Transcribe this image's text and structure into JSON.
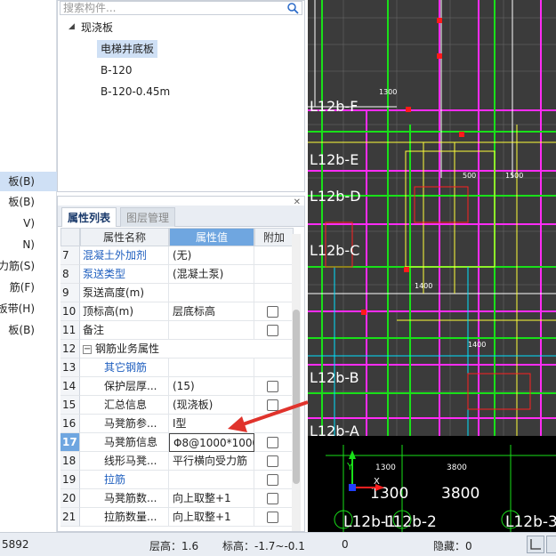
{
  "left_nav": {
    "items": [
      {
        "label": "板(B)",
        "selected": true
      },
      {
        "label": "板(B)",
        "selected": false
      },
      {
        "label": "V)",
        "selected": false
      },
      {
        "label": "N)",
        "selected": false
      },
      {
        "label": "力筋(S)",
        "selected": false
      },
      {
        "label": "筋(F)",
        "selected": false
      },
      {
        "label": "板带(H)",
        "selected": false
      },
      {
        "label": "板(B)",
        "selected": false
      }
    ]
  },
  "tree": {
    "search_placeholder": "搜索构件...",
    "root": "现浇板",
    "children": [
      {
        "label": "电梯井底板",
        "selected": true
      },
      {
        "label": "B-120",
        "selected": false
      },
      {
        "label": "B-120-0.45m",
        "selected": false
      }
    ]
  },
  "props": {
    "tabs": [
      "属性列表",
      "图层管理"
    ],
    "headers": {
      "name": "属性名称",
      "value": "属性值",
      "extra": "附加"
    },
    "rows": [
      {
        "num": "7",
        "name": "混凝土外加剂",
        "value": "(无)",
        "blue": true,
        "checkbox": false
      },
      {
        "num": "8",
        "name": "泵送类型",
        "value": "(混凝土泵)",
        "blue": true,
        "checkbox": false
      },
      {
        "num": "9",
        "name": "泵送高度(m)",
        "value": "",
        "blue": false,
        "checkbox": false
      },
      {
        "num": "10",
        "name": "顶标高(m)",
        "value": "层底标高",
        "blue": false,
        "checkbox": true
      },
      {
        "num": "11",
        "name": "备注",
        "value": "",
        "blue": false,
        "checkbox": true
      },
      {
        "num": "12",
        "name": "钢筋业务属性",
        "value": "",
        "blue": false,
        "checkbox": false,
        "group": true
      },
      {
        "num": "13",
        "name": "其它钢筋",
        "value": "",
        "blue": true,
        "checkbox": false,
        "indent": true
      },
      {
        "num": "14",
        "name": "保护层厚...",
        "value": "(15)",
        "blue": false,
        "checkbox": true,
        "indent": true
      },
      {
        "num": "15",
        "name": "汇总信息",
        "value": "(现浇板)",
        "blue": false,
        "checkbox": true,
        "indent": true
      },
      {
        "num": "16",
        "name": "马凳筋参...",
        "value": "Ⅰ型",
        "blue": false,
        "checkbox": false,
        "indent": true
      },
      {
        "num": "17",
        "name": "马凳筋信息",
        "value": "Φ8@1000*1000",
        "blue": false,
        "checkbox": true,
        "indent": true,
        "current": true
      },
      {
        "num": "18",
        "name": "线形马凳...",
        "value": "平行横向受力筋",
        "blue": false,
        "checkbox": true,
        "indent": true
      },
      {
        "num": "19",
        "name": "拉筋",
        "value": "",
        "blue": true,
        "checkbox": true,
        "indent": true
      },
      {
        "num": "20",
        "name": "马凳筋数...",
        "value": "向上取整+1",
        "blue": false,
        "checkbox": true,
        "indent": true
      },
      {
        "num": "21",
        "name": "拉筋数量...",
        "value": "向上取整+1",
        "blue": false,
        "checkbox": true,
        "indent": true
      }
    ]
  },
  "cad": {
    "axis_labels_y": [
      "L12b-F",
      "L12b-E",
      "L12b-D",
      "L12b-C",
      "L12b-B",
      "L12b-A"
    ],
    "axis_labels_x": [
      "L12b-1",
      "L12b-2",
      "L12b-3"
    ],
    "dims_small": [
      "1300",
      "1400",
      "500",
      "1500",
      "1400",
      "1300",
      "3800"
    ],
    "dims_large": [
      "1300",
      "3800"
    ],
    "ucs_y": "Y",
    "ucs_x": "X"
  },
  "status": {
    "coord": "5892",
    "floor_height": "层高：1.6",
    "elevation": "标高：-1.7~-0.1",
    "count": "0",
    "hidden": "隐藏：0"
  },
  "colors": {
    "accent": "#6fa6e0",
    "selection": "#cfe0f5",
    "cad_bg": "#000000",
    "arrow": "#e0332c"
  }
}
